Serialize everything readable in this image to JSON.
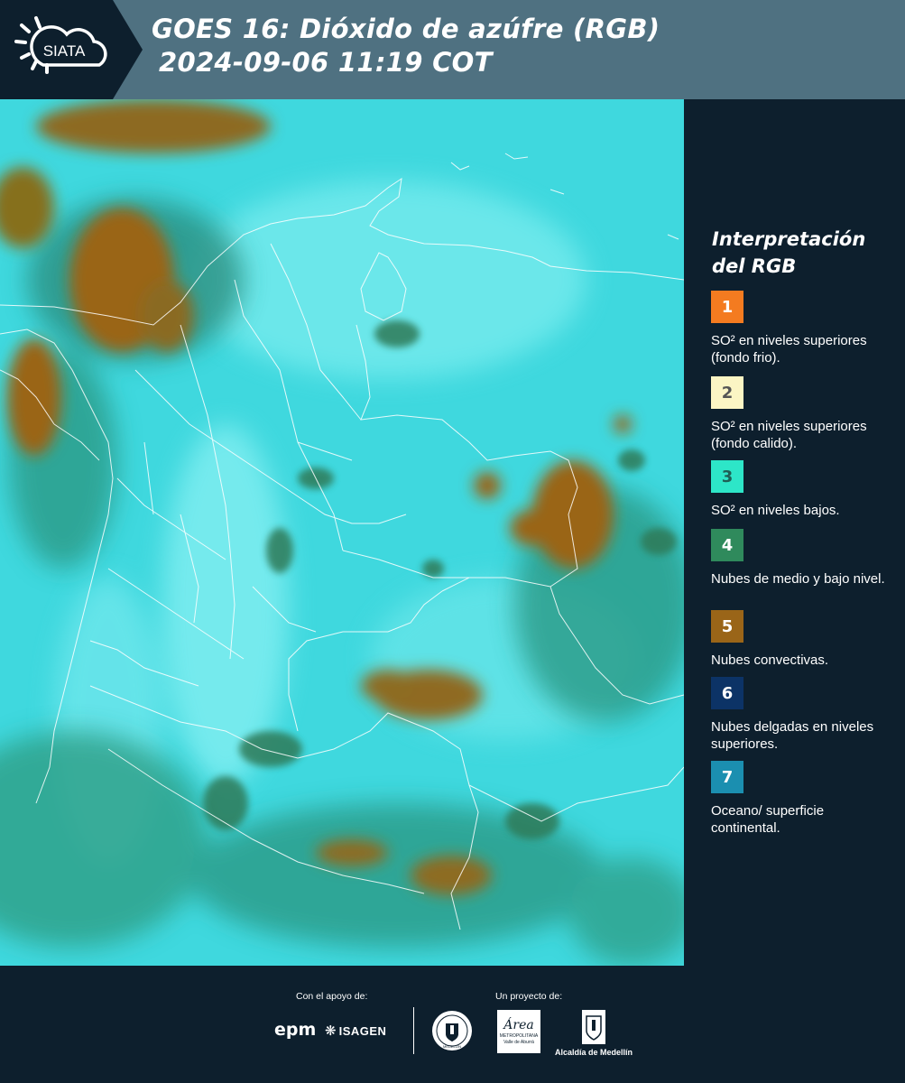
{
  "header": {
    "logo_text": "SIATA",
    "title_line1": "GOES 16: Dióxido de azúfre (RGB)",
    "title_line2": "2024-09-06 11:19 COT"
  },
  "legend": {
    "title": "Interpretación del RGB",
    "items": [
      {
        "number": "1",
        "label": "SO² en niveles superiores (fondo frio).",
        "color": "#f47b20",
        "text_color": "#ffffff"
      },
      {
        "number": "2",
        "label": "SO² en niveles superiores (fondo calido).",
        "color": "#fbf5c4",
        "text_color": "#555555"
      },
      {
        "number": "3",
        "label": "SO² en niveles bajos.",
        "color": "#2de6c8",
        "text_color": "#1f5f55"
      },
      {
        "number": "4",
        "label": "Nubes de medio y bajo nivel.",
        "color": "#2f8a5c",
        "text_color": "#ffffff"
      },
      {
        "number": "5",
        "label": "Nubes convectivas.",
        "color": "#9a6518",
        "text_color": "#ffffff"
      },
      {
        "number": "6",
        "label": "Nubes delgadas en niveles superiores.",
        "color": "#0c3366",
        "text_color": "#ffffff"
      },
      {
        "number": "7",
        "label": "Oceano/ superficie continental.",
        "color": "#1b8fb0",
        "text_color": "#ffffff"
      }
    ]
  },
  "footer": {
    "support_caption": "Con el apoyo de:",
    "project_caption": "Un proyecto de:",
    "sponsor_epm": "epm",
    "sponsor_isagen": "ISAGEN",
    "partner_medellin_seal": "MEDELLÍN",
    "partner_area_name": "Área",
    "partner_area_line1": "METROPOLITANA",
    "partner_area_line2": "Valle de Aburrá",
    "partner_alcaldia": "Alcaldía de Medellín"
  },
  "colors": {
    "background": "#0d1f2d",
    "header": "#4f7181",
    "land_cyan": "#3fd8de",
    "convective": "#9a6518",
    "mid_low_clouds": "#2f8a5c"
  }
}
